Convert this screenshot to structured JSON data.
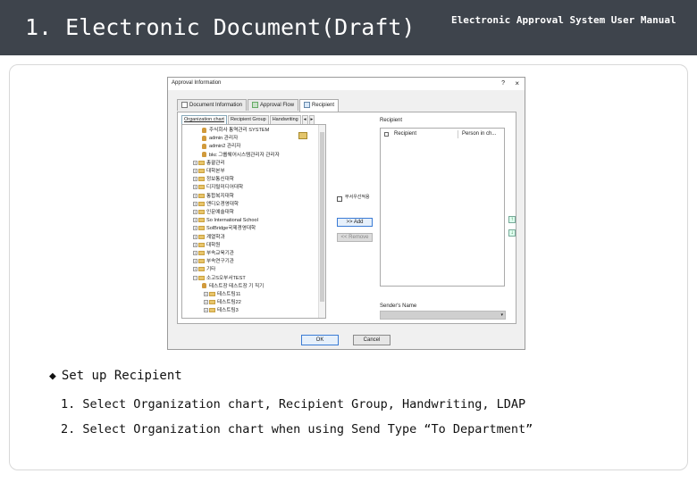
{
  "header": {
    "title": "1. Electronic Document(Draft)",
    "manual": "Electronic Approval System User Manual"
  },
  "dialog": {
    "title": "Approval Information",
    "help": "?",
    "close": "×",
    "tabs": [
      {
        "label": "Document Information"
      },
      {
        "label": "Approval Flow"
      },
      {
        "label": "Recipient"
      }
    ],
    "subtabs": [
      {
        "label": "Organization chart"
      },
      {
        "label": "Recipient Group"
      },
      {
        "label": "Handwriting"
      },
      {
        "label": "◂"
      },
      {
        "label": "▸"
      }
    ],
    "tree": [
      {
        "type": "user",
        "exp": "",
        "label": "주식회사 통역관리 SYSTEM"
      },
      {
        "type": "user",
        "exp": "",
        "label": "admin 관리자"
      },
      {
        "type": "user",
        "exp": "",
        "label": "admin2 관리자"
      },
      {
        "type": "user",
        "exp": "",
        "label": "bkc 그룹웨어시스템관리자 관리자"
      },
      {
        "type": "folder",
        "exp": "+",
        "label": "총괄관리"
      },
      {
        "type": "folder",
        "exp": "+",
        "label": "대학본부"
      },
      {
        "type": "folder",
        "exp": "+",
        "label": "정보통신대학"
      },
      {
        "type": "folder",
        "exp": "+",
        "label": "디지털미디어대학"
      },
      {
        "type": "folder",
        "exp": "+",
        "label": "통합복지대학"
      },
      {
        "type": "folder",
        "exp": "+",
        "label": "앤디오경영대학"
      },
      {
        "type": "folder",
        "exp": "+",
        "label": "인문예술대학"
      },
      {
        "type": "folder",
        "exp": "+",
        "label": "So International School"
      },
      {
        "type": "folder",
        "exp": "+",
        "label": "SolBridge국제경영대학"
      },
      {
        "type": "folder",
        "exp": "+",
        "label": "계열학과"
      },
      {
        "type": "folder",
        "exp": "+",
        "label": "대학원"
      },
      {
        "type": "folder",
        "exp": "+",
        "label": "부속교육기관"
      },
      {
        "type": "folder",
        "exp": "+",
        "label": "부속연구기관"
      },
      {
        "type": "folder",
        "exp": "+",
        "label": "기타"
      },
      {
        "type": "folder",
        "exp": "−",
        "label": "소고S오부서TEST"
      },
      {
        "type": "user",
        "exp": "",
        "label": "테스트장 테스트장 기 직기"
      },
      {
        "type": "folder",
        "exp": "+",
        "label": "테스트팀11"
      },
      {
        "type": "folder",
        "exp": "+",
        "label": "테스트팀22"
      },
      {
        "type": "folder",
        "exp": "+",
        "label": "테스트팀3"
      }
    ],
    "checkbox_label": "부서우선적용",
    "add_label": ">> Add",
    "remove_label": "<< Remove",
    "recipient_label": "Recipient",
    "col_recipient": "Recipient",
    "col_person": "Person in ch...",
    "up_icon": "↑",
    "down_icon": "↓",
    "sender_label": "Sender's Name",
    "sender_value": "",
    "ok_label": "OK",
    "cancel_label": "Cancel"
  },
  "notes": {
    "bullet": "Set up Recipient",
    "step1": "1. Select Organization chart, Recipient Group, Handwriting, LDAP",
    "step2": "2. Select Organization chart when using Send Type  “To Department”"
  },
  "colors": {
    "header_bg": "#3e444c",
    "accent_blue": "#3a7bd5"
  }
}
